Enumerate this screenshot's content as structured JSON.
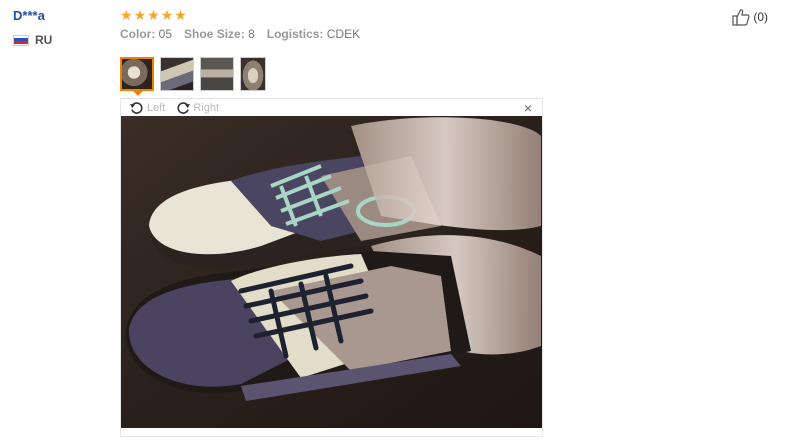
{
  "reviewer": {
    "name": "D***a",
    "country_code": "RU"
  },
  "review": {
    "stars": 5,
    "attributes": [
      {
        "label": "Color:",
        "value": "05"
      },
      {
        "label": "Shoe Size:",
        "value": "8"
      },
      {
        "label": "Logistics:",
        "value": "CDEK"
      }
    ]
  },
  "thumbnails": {
    "count": 4,
    "active_index": 0
  },
  "viewer": {
    "rotate_left_label": "Left",
    "rotate_right_label": "Right",
    "close_label": "×"
  },
  "like": {
    "count_text": "(0)"
  },
  "colors": {
    "star": "#f5a623",
    "active_thumb_border": "#f08200",
    "reviewer_name": "#1f4fa8"
  }
}
